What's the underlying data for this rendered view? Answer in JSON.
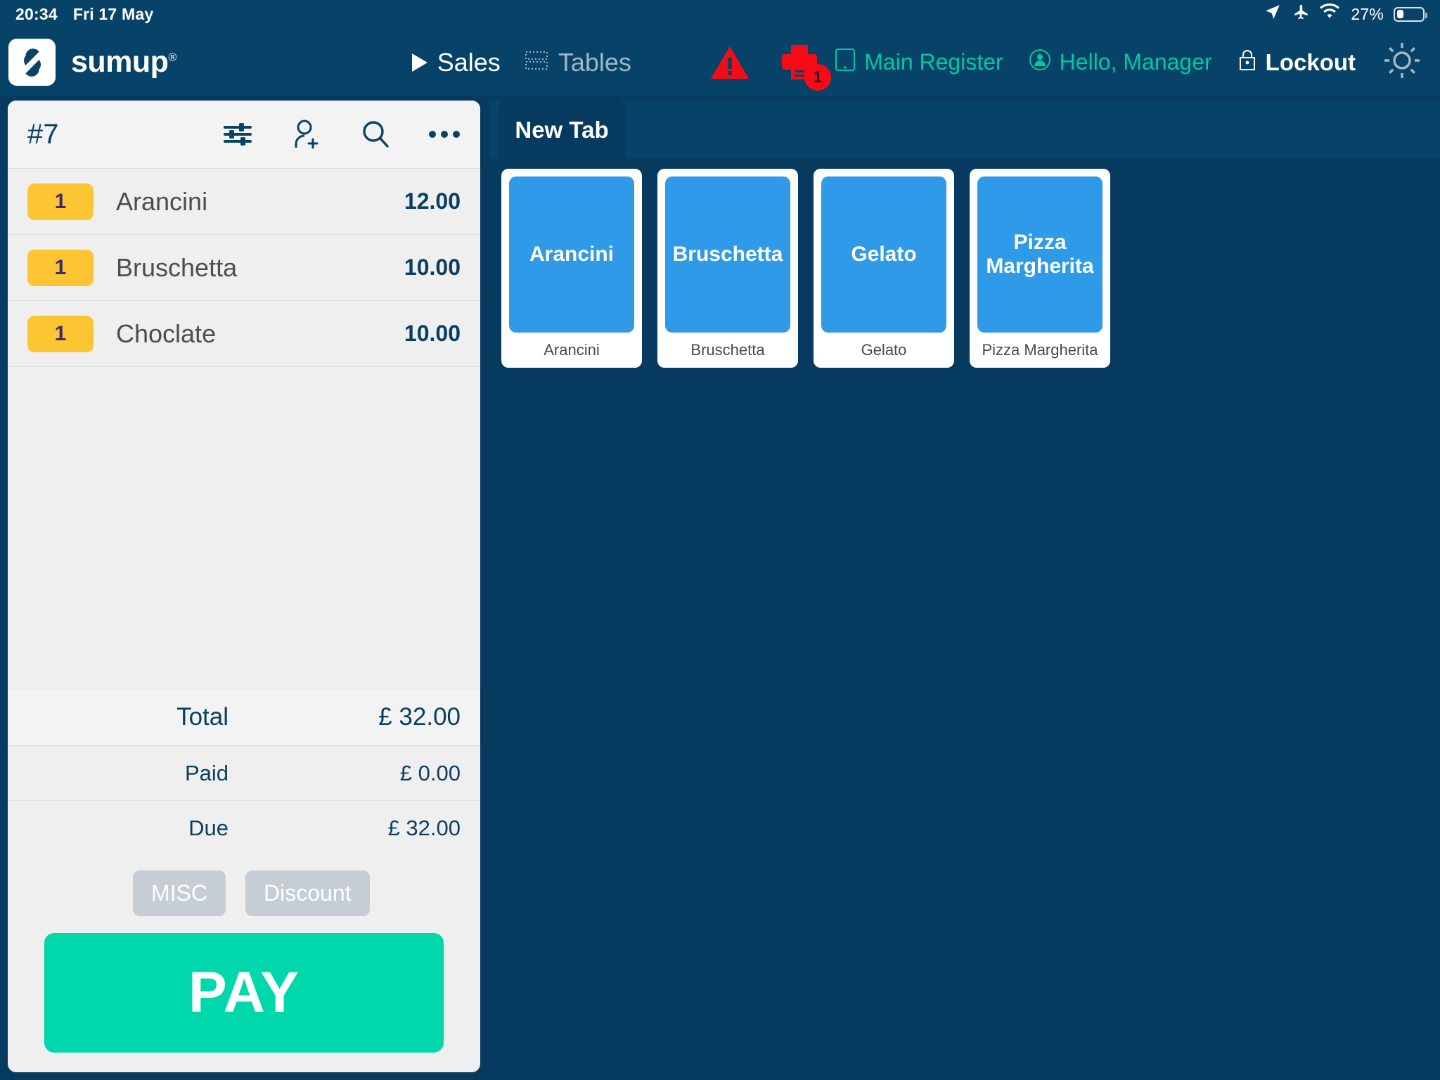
{
  "status_bar": {
    "time": "20:34",
    "date": "Fri 17 May",
    "battery_percent": "27%",
    "icons": [
      "location-arrow-icon",
      "airplane-mode-icon",
      "wifi-icon",
      "battery-icon"
    ]
  },
  "top_nav": {
    "brand": "sumup",
    "brand_trademark": "®",
    "sales_label": "Sales",
    "tables_label": "Tables",
    "warning_icon": "warning-triangle-icon",
    "printer_icon": "printer-icon",
    "printer_badge": "1",
    "register_label": "Main Register",
    "user_greeting": "Hello, Manager",
    "lockout_label": "Lockout",
    "settings_icon": "gear-icon"
  },
  "order": {
    "id": "#7",
    "tools": [
      "sliders-icon",
      "add-customer-icon",
      "search-icon",
      "more-options-icon"
    ],
    "items": [
      {
        "qty": "1",
        "name": "Arancini",
        "price": "12.00"
      },
      {
        "qty": "1",
        "name": "Bruschetta",
        "price": "10.00"
      },
      {
        "qty": "1",
        "name": "Choclate",
        "price": "10.00"
      }
    ],
    "total_label": "Total",
    "total_value": "£ 32.00",
    "paid_label": "Paid",
    "paid_value": "£ 0.00",
    "due_label": "Due",
    "due_value": "£ 32.00",
    "misc_label": "MISC",
    "discount_label": "Discount",
    "pay_label": "PAY"
  },
  "catalog": {
    "tab_label": "New Tab",
    "products": [
      {
        "tile_label": "Arancini",
        "caption": "Arancini"
      },
      {
        "tile_label": "Bruschetta",
        "caption": "Bruschetta"
      },
      {
        "tile_label": "Gelato",
        "caption": "Gelato"
      },
      {
        "tile_label": "Pizza Margherita",
        "caption": "Pizza Margherita"
      }
    ]
  },
  "colors": {
    "nav_blue": "#074368",
    "content_blue": "#063a5e",
    "accent_teal": "#00d7ab",
    "tile_blue": "#2f9ae8",
    "qty_yellow": "#fcc633",
    "alert_red": "#f50b15",
    "panel_gray": "#efefef"
  }
}
